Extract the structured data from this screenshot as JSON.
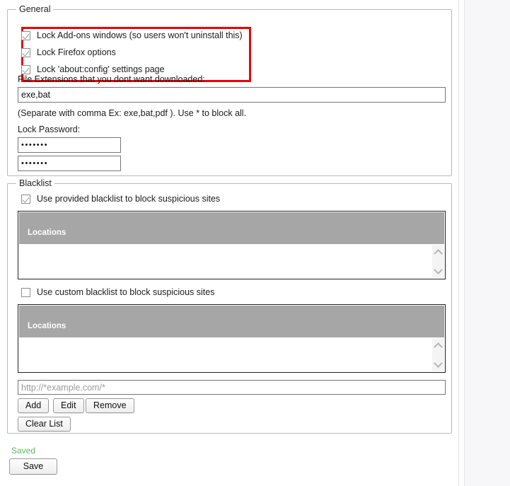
{
  "general": {
    "legend": "General",
    "checkboxes": [
      {
        "label": "Lock Add-ons windows (so users won't uninstall this)",
        "checked": true
      },
      {
        "label": "Lock Firefox options",
        "checked": true
      },
      {
        "label": "Lock 'about:config' settings page",
        "checked": true
      }
    ],
    "file_ext_label": "File Extensions that you dont want downloaded:",
    "file_ext_value": "exe,bat",
    "file_ext_hint": "(Separate with comma Ex: exe,bat,pdf ). Use * to block all.",
    "lock_password_label": "Lock Password:",
    "password_value": "•••••••",
    "password_confirm_value": "•••••••"
  },
  "blacklist": {
    "legend": "Blacklist",
    "provided": {
      "checkbox_label": "Use provided blacklist to block suspicious sites",
      "checked": true,
      "column_header": "Locations",
      "rows": []
    },
    "custom": {
      "checkbox_label": "Use custom blacklist to block suspicious sites",
      "checked": false,
      "column_header": "Locations",
      "rows": []
    },
    "url_input_placeholder": "http://*example.com/*",
    "url_input_value": "",
    "buttons": {
      "add": "Add",
      "edit": "Edit",
      "remove": "Remove",
      "clear_list": "Clear List"
    }
  },
  "footer": {
    "status": "Saved",
    "status_color": "#5cb85c",
    "save_button": "Save"
  },
  "icons": {
    "scroll_up": "chevron-up-icon",
    "scroll_down": "chevron-down-icon"
  }
}
